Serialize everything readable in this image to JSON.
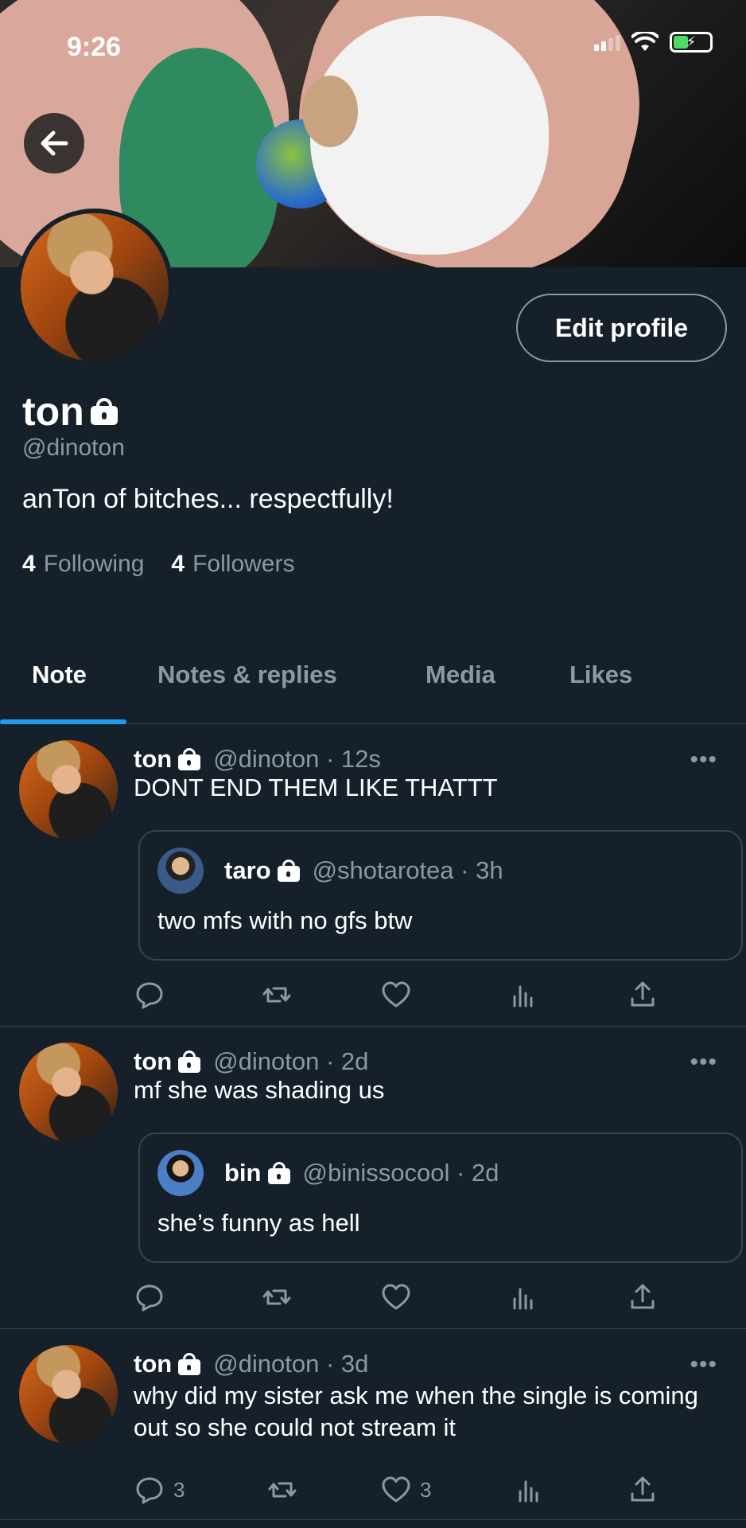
{
  "status": {
    "time": "9:26"
  },
  "profile": {
    "name": "ton",
    "handle": "@dinoton",
    "bio": "anTon of bitches... respectfully!",
    "following_count": "4",
    "following_label": "Following",
    "followers_count": "4",
    "followers_label": "Followers",
    "edit_label": "Edit profile"
  },
  "tabs": [
    {
      "label": "Note",
      "active": true
    },
    {
      "label": "Notes & replies",
      "active": false
    },
    {
      "label": "Media",
      "active": false
    },
    {
      "label": "Likes",
      "active": false
    }
  ],
  "posts": [
    {
      "name": "ton",
      "meta": "@dinoton · 12s",
      "text": "DONT END THEM LIKE THATTT",
      "quote": {
        "name": "taro",
        "meta": "@shotarotea · 3h",
        "text": "two mfs with no gfs btw"
      },
      "reply_count": "",
      "like_count": ""
    },
    {
      "name": "ton",
      "meta": "@dinoton · 2d",
      "text": "mf she was shading us",
      "quote": {
        "name": "bin",
        "meta": "@binissocool · 2d",
        "text": "she’s funny as hell"
      },
      "reply_count": "",
      "like_count": ""
    },
    {
      "name": "ton",
      "meta": "@dinoton · 3d",
      "text": "why did my sister ask me when the single is coming out so she could not stream it",
      "reply_count": "3",
      "like_count": "3"
    }
  ],
  "icons": {
    "back": "arrow-left-icon",
    "more": "more-horizontal-icon",
    "reply": "reply-icon",
    "retweet": "retweet-icon",
    "like": "heart-icon",
    "views": "views-icon",
    "share": "share-icon",
    "lock": "lock-icon"
  },
  "colors": {
    "background": "#15202b",
    "accent": "#1d9bf0",
    "secondary_text": "#8b98a5",
    "divider": "#38444d"
  }
}
